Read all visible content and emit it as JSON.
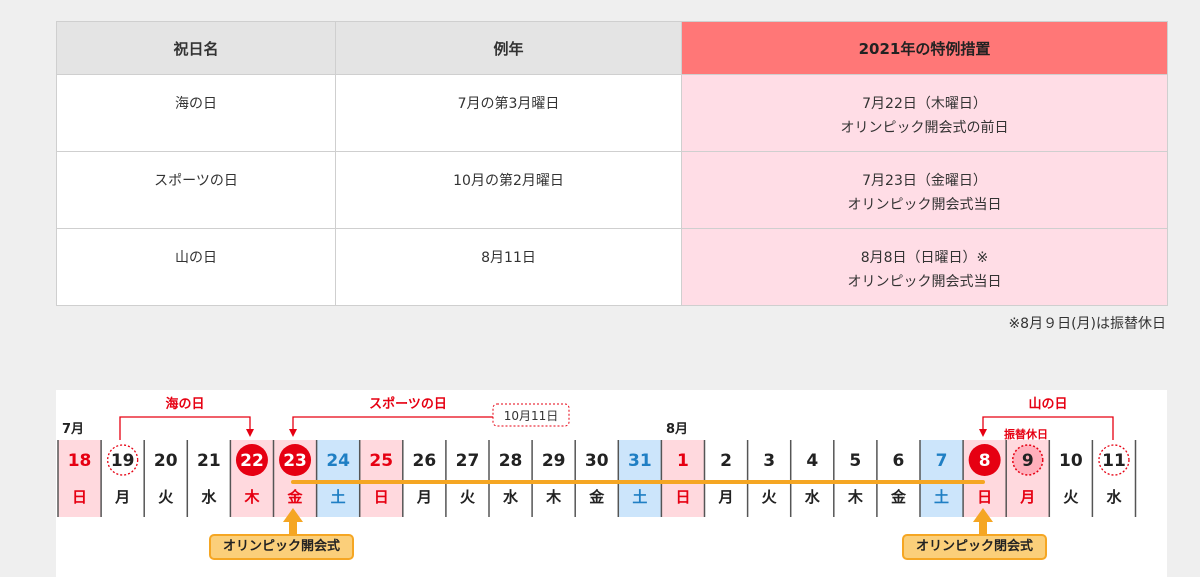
{
  "table": {
    "headers": [
      "祝日名",
      "例年",
      "2021年の特例措置"
    ],
    "rows": [
      {
        "name": "海の日",
        "usual": "7月の第3月曜日",
        "special_line1": "7月22日（木曜日）",
        "special_line2": "オリンピック開会式の前日"
      },
      {
        "name": "スポーツの日",
        "usual": "10月の第2月曜日",
        "special_line1": "7月23日（金曜日）",
        "special_line2": "オリンピック開会式当日"
      },
      {
        "name": "山の日",
        "usual": "8月11日",
        "special_line1": "8月8日（日曜日）※",
        "special_line2": "オリンピック開会式当日"
      }
    ],
    "note": "※8月９日(月)は振替休日"
  },
  "calendar": {
    "month_july": "7月",
    "month_august": "8月",
    "label_umi": "海の日",
    "label_sports": "スポーツの日",
    "label_sports_original": "10月11日",
    "label_yama": "山の日",
    "label_furikae": "振替休日",
    "opening_left": "オリンピック開会式",
    "opening_right": "オリンピック閉会式",
    "days": [
      {
        "num": "18",
        "wd": "日",
        "type": "sun"
      },
      {
        "num": "19",
        "wd": "月",
        "type": "dotted"
      },
      {
        "num": "20",
        "wd": "火",
        "type": "normal"
      },
      {
        "num": "21",
        "wd": "水",
        "type": "normal"
      },
      {
        "num": "22",
        "wd": "木",
        "type": "holiday"
      },
      {
        "num": "23",
        "wd": "金",
        "type": "holiday"
      },
      {
        "num": "24",
        "wd": "土",
        "type": "sat"
      },
      {
        "num": "25",
        "wd": "日",
        "type": "sun"
      },
      {
        "num": "26",
        "wd": "月",
        "type": "normal"
      },
      {
        "num": "27",
        "wd": "火",
        "type": "normal"
      },
      {
        "num": "28",
        "wd": "水",
        "type": "normal"
      },
      {
        "num": "29",
        "wd": "木",
        "type": "normal"
      },
      {
        "num": "30",
        "wd": "金",
        "type": "normal"
      },
      {
        "num": "31",
        "wd": "土",
        "type": "sat"
      },
      {
        "num": "1",
        "wd": "日",
        "type": "sun"
      },
      {
        "num": "2",
        "wd": "月",
        "type": "normal"
      },
      {
        "num": "3",
        "wd": "火",
        "type": "normal"
      },
      {
        "num": "4",
        "wd": "水",
        "type": "normal"
      },
      {
        "num": "5",
        "wd": "木",
        "type": "normal"
      },
      {
        "num": "6",
        "wd": "金",
        "type": "normal"
      },
      {
        "num": "7",
        "wd": "土",
        "type": "sat"
      },
      {
        "num": "8",
        "wd": "日",
        "type": "holiday-sun"
      },
      {
        "num": "9",
        "wd": "月",
        "type": "furikae"
      },
      {
        "num": "10",
        "wd": "火",
        "type": "normal"
      },
      {
        "num": "11",
        "wd": "水",
        "type": "dotted"
      }
    ],
    "colors": {
      "red": "#e60012",
      "sun_bg": "#ffd9de",
      "sat_bg": "#cce5fb",
      "sat_text": "#1f7fc4",
      "orange": "#f5a623"
    }
  }
}
